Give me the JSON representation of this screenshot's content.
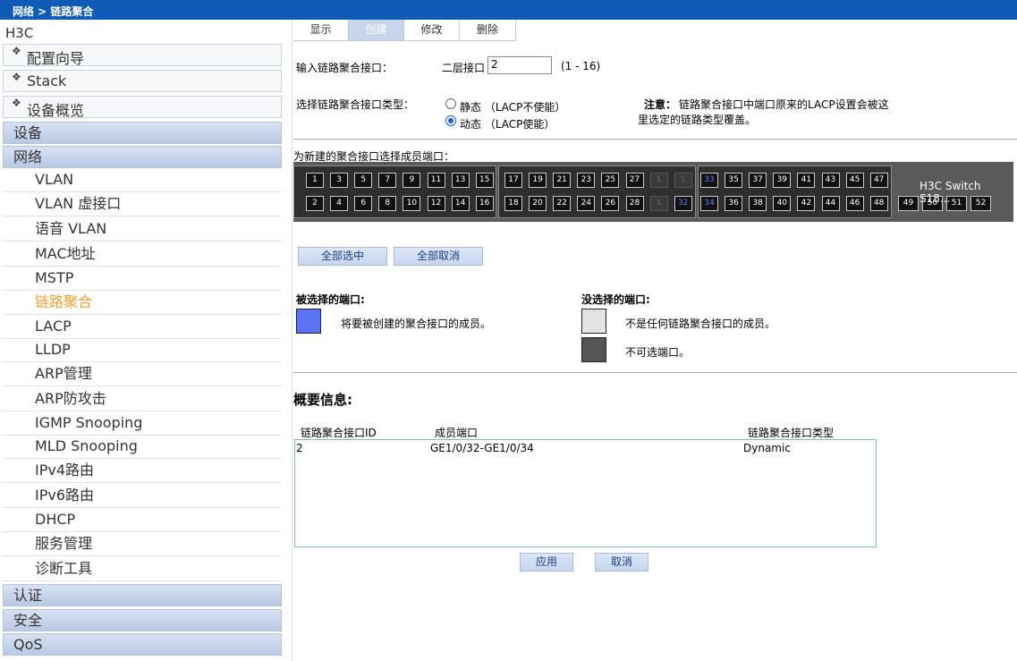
{
  "breadcrumb": "网络 > 链路聚合",
  "sidebar": {
    "brand": "H3C",
    "top_links": [
      "配置向导",
      "Stack",
      "设备概览"
    ],
    "categories": [
      "设备",
      "网络"
    ],
    "network_items": [
      "VLAN",
      "VLAN 虚接口",
      "语音 VLAN",
      "MAC地址",
      "MSTP",
      "链路聚合",
      "LACP",
      "LLDP",
      "ARP管理",
      "ARP防攻击",
      "IGMP Snooping",
      "MLD Snooping",
      "IPv4路由",
      "IPv6路由",
      "DHCP",
      "服务管理",
      "诊断工具"
    ],
    "bottom_categories": [
      "认证",
      "安全",
      "QoS"
    ],
    "active_item": "链路聚合"
  },
  "tabs": [
    "显示",
    "创建",
    "修改",
    "删除"
  ],
  "active_tab": "创建",
  "form": {
    "input_label": "输入链路聚合接口：",
    "l2_label": "二层接口",
    "l2_value": "2",
    "range": "(1 - 16)",
    "type_label": "选择链路聚合接口类型：",
    "static_label": "静态 （LACP不使能）",
    "dynamic_label": "动态 （LACP使能）",
    "selected_type": "dynamic",
    "note_title": "注意：",
    "note_line1": "链路聚合接口中端口原来的LACP设置会被这",
    "note_line2": "里选定的链路类型覆盖。"
  },
  "ports": {
    "label": "为新建的聚合接口选择成员端口：",
    "top_row": [
      "1",
      "3",
      "5",
      "7",
      "9",
      "11",
      "13",
      "15",
      "17",
      "19",
      "21",
      "23",
      "25",
      "27",
      "1",
      "1",
      "33",
      "35",
      "37",
      "39",
      "41",
      "43",
      "45",
      "47"
    ],
    "bottom_row": [
      "2",
      "4",
      "6",
      "8",
      "10",
      "12",
      "14",
      "16",
      "18",
      "20",
      "22",
      "24",
      "26",
      "28",
      "1",
      "32",
      "34",
      "36",
      "38",
      "40",
      "42",
      "44",
      "46",
      "48"
    ],
    "sfp": [
      "49",
      "50",
      "51",
      "52"
    ],
    "model": "H3C Switch S18..."
  },
  "buttons": {
    "select_all": "全部选中",
    "deselect_all": "全部取消",
    "apply": "应用",
    "cancel": "取消"
  },
  "legend": {
    "selected_title": "被选择的端口:",
    "selected_desc": "将要被创建的聚合接口的成员。",
    "unselected_title": "没选择的端口:",
    "unselected_desc": "不是任何链路聚合接口的成员。",
    "unavailable_desc": "不可选端口。",
    "colors": {
      "selected": "#5a73f4",
      "unselected": "#e4e4e4",
      "unavailable": "#555555"
    }
  },
  "summary": {
    "title": "概要信息:",
    "headers": [
      "链路聚合接口ID",
      "成员端口",
      "链路聚合接口类型"
    ],
    "rows": [
      [
        "2",
        "GE1/0/32-GE1/0/34",
        "Dynamic"
      ]
    ]
  }
}
